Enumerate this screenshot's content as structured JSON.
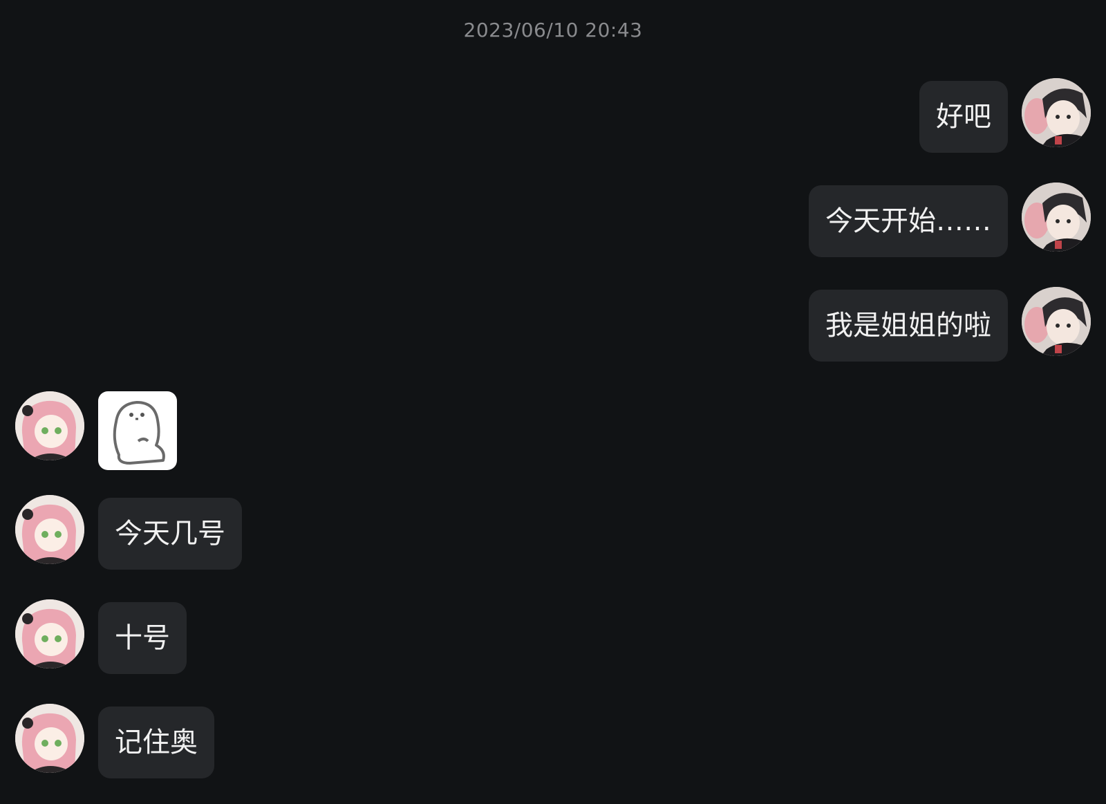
{
  "conversation": {
    "timestamp": "2023/06/10 20:43",
    "messages": [
      {
        "side": "right",
        "type": "text",
        "text": "好吧"
      },
      {
        "side": "right",
        "type": "text",
        "text": "今天开始……"
      },
      {
        "side": "right",
        "type": "text",
        "text": "我是姐姐的啦"
      },
      {
        "side": "left",
        "type": "sticker",
        "icon": "ghost-sticker-icon"
      },
      {
        "side": "left",
        "type": "text",
        "text": "今天几号"
      },
      {
        "side": "left",
        "type": "text",
        "text": "十号"
      },
      {
        "side": "left",
        "type": "text",
        "text": "记住奥"
      }
    ]
  },
  "colors": {
    "background": "#111315",
    "bubble": "#25272a",
    "bubble_text": "#f1f1f1",
    "timestamp_text": "#8a8b8e"
  }
}
